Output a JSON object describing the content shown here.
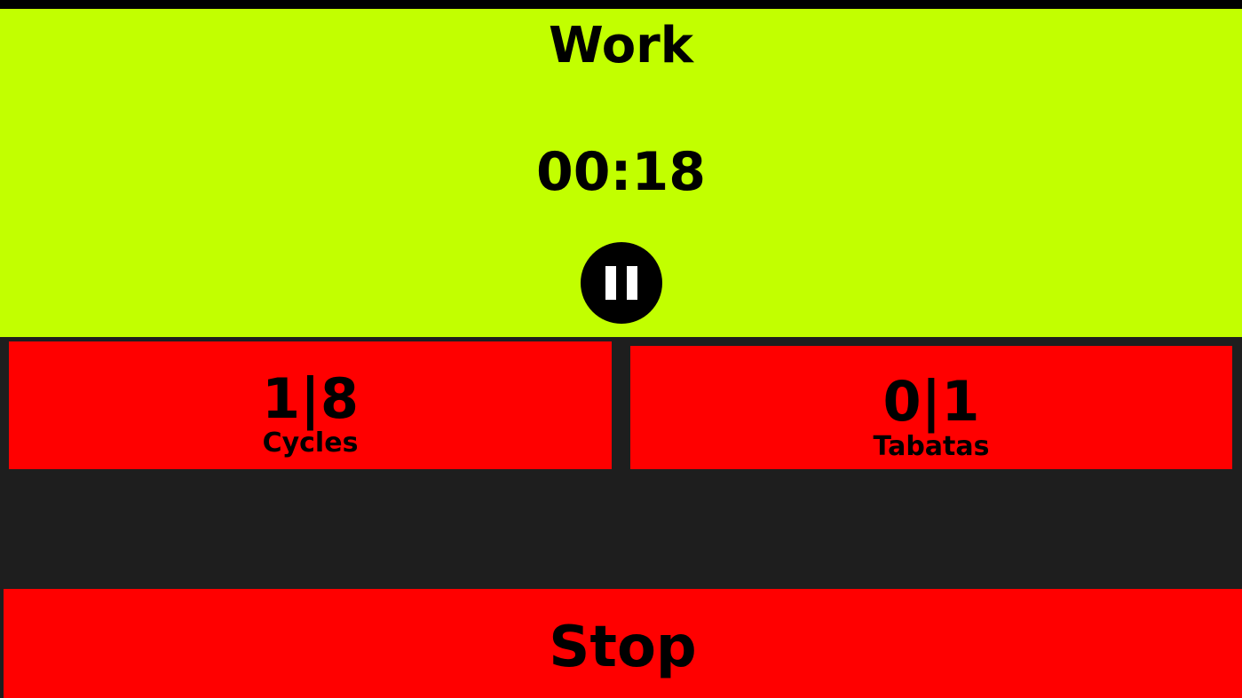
{
  "colors": {
    "work_background": "#c2ff00",
    "stat_background": "#ff0000",
    "stop_background": "#ff0000",
    "app_background": "#1e1e1e"
  },
  "timer_panel": {
    "phase": "Work",
    "time": "00:18",
    "pause_icon": "pause-icon"
  },
  "stats": {
    "cycles": {
      "value": "1|8",
      "label": "Cycles"
    },
    "tabatas": {
      "value": "0|1",
      "label": "Tabatas"
    }
  },
  "controls": {
    "stop_label": "Stop"
  }
}
